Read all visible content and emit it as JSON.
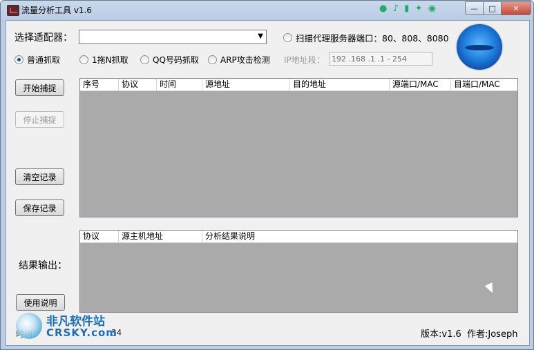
{
  "window": {
    "title": "流量分析工具 v1.6",
    "close_glyph": "✕",
    "max_glyph": "□",
    "min_glyph": "—"
  },
  "toolbar": {
    "adapter_label": "选择适配器：",
    "adapter_value": "",
    "scan_proxy_label": "扫描代理服务器端口：80、808、8080"
  },
  "capture_modes": {
    "selected": "普通抓取",
    "options": [
      "普通抓取",
      "1拖N抓取",
      "QQ号码抓取",
      "ARP攻击检测"
    ]
  },
  "ip_range": {
    "label": "IP地址段：",
    "value": "192 .168 .1    .1   -  254"
  },
  "buttons": {
    "start": "开始捕捉",
    "stop": "停止捕捉",
    "clear": "清空记录",
    "save": "保存记录",
    "help": "使用说明"
  },
  "packets_table": {
    "columns": [
      "序号",
      "协议",
      "时间",
      "源地址",
      "目的地址",
      "源端口/MAC",
      "目端口/MAC"
    ],
    "rows": []
  },
  "results": {
    "label": "结果输出：",
    "columns": [
      "协议",
      "源主机地址",
      "分析结果说明"
    ],
    "rows": []
  },
  "status": {
    "time_label": "时间：",
    "time_value": "34",
    "version": "版本:v1.6",
    "author": "作者:Joseph"
  },
  "watermark": {
    "cn": "非凡软件站",
    "en": "CRSKY.com"
  }
}
